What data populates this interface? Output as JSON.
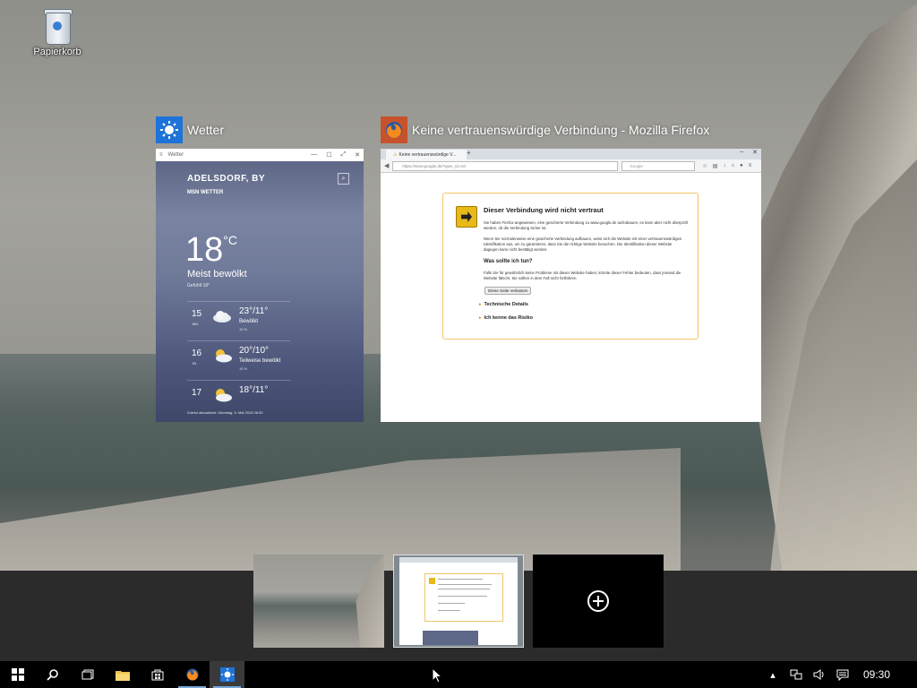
{
  "desktop": {
    "icons": [
      {
        "label": "Papierkorb",
        "icon": "recycle-bin-icon"
      }
    ]
  },
  "windows": {
    "weather": {
      "title": "Wetter",
      "app_title_bar": "Wetter",
      "city": "ADELSDORF, BY",
      "source": "MSN WETTER",
      "temperature": "18",
      "unit": "°C",
      "condition": "Meist bewölkt",
      "feels_like": "Gefühlt 18°",
      "days": [
        {
          "num": "15",
          "weekday": "MO",
          "hi_lo": "23°/11°",
          "cond": "Bewölkt",
          "precip": "10 %"
        },
        {
          "num": "16",
          "weekday": "DI",
          "hi_lo": "20°/10°",
          "cond": "Teilweise bewölkt",
          "precip": "10 %"
        },
        {
          "num": "17",
          "weekday": "",
          "hi_lo": "18°/11°",
          "cond": "",
          "precip": ""
        }
      ],
      "updated": "Zuletzt aktualisiert: Dienstag, 5. Mai 2015 08:30"
    },
    "firefox": {
      "title": "Keine vertrauenswürdige Verbindung - Mozilla Firefox",
      "tab_label": "Keine vertrauenswürdige V...",
      "url": "https://www.google.de/?gws_rd=ssl",
      "search_placeholder": "Google",
      "error_title": "Dieser Verbindung wird nicht vertraut",
      "error_p1": "Sie haben Firefox angewiesen, eine gesicherte Verbindung zu www.google.de aufzubauen, es kann aber nicht überprüft werden, ob die Verbindung sicher ist.",
      "error_p2": "Wenn Sie normalerweise eine gesicherte Verbindung aufbauen, weist sich die Website mit einer vertrauenswürdigen Identifikation aus, um zu garantieren, dass Sie die richtige Website besuchen. Die Identifikation dieser Website dagegen kann nicht bestätigt werden.",
      "what_to_do": "Was sollte ich tun?",
      "error_p3": "Falls Sie für gewöhnlich keine Probleme mit dieser Website haben, könnte dieser Fehler bedeuten, dass jemand die Website fälscht. Sie sollten in dem Fall nicht fortfahren.",
      "leave_button": "Diese Seite verlassen",
      "tech_details": "Technische Details",
      "risk": "Ich kenne das Risiko"
    }
  },
  "taskbar": {
    "clock": "09:30",
    "pinned": [
      {
        "name": "start-button-icon"
      },
      {
        "name": "search-icon"
      },
      {
        "name": "task-view-icon"
      },
      {
        "name": "file-explorer-icon"
      },
      {
        "name": "store-icon"
      },
      {
        "name": "firefox-icon"
      },
      {
        "name": "weather-icon"
      }
    ],
    "tray": [
      "chevron-up-icon",
      "network-icon",
      "volume-icon",
      "action-center-icon"
    ]
  },
  "colors": {
    "accent": "#1e73d8",
    "taskbar": "#000000",
    "strip": "#2b2b2b"
  }
}
